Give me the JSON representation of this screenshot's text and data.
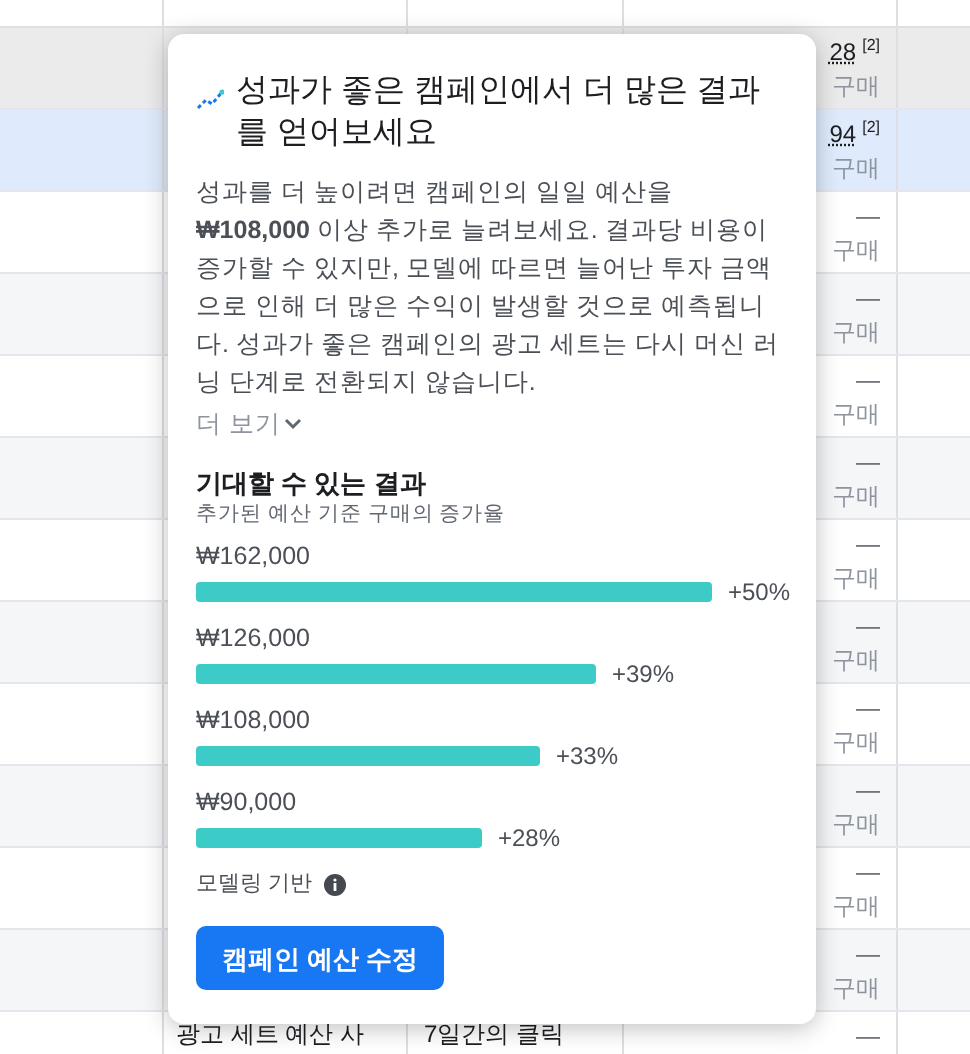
{
  "table": {
    "rows": [
      {
        "value": "28",
        "note": "[2]",
        "sub": "구매",
        "selected": false
      },
      {
        "value": "94",
        "note": "[2]",
        "sub": "구매",
        "selected": true
      },
      {
        "value": "—",
        "sub": "구매",
        "selected": false
      },
      {
        "value": "—",
        "sub": "구매",
        "selected": false
      },
      {
        "value": "—",
        "sub": "구매",
        "selected": false
      },
      {
        "value": "—",
        "sub": "구매",
        "selected": false
      },
      {
        "value": "—",
        "sub": "구매",
        "selected": false
      },
      {
        "value": "—",
        "sub": "구매",
        "selected": false
      },
      {
        "value": "—",
        "sub": "구매",
        "selected": false
      },
      {
        "value": "—",
        "sub": "구매",
        "selected": false
      },
      {
        "value": "—",
        "sub": "구매",
        "selected": false
      },
      {
        "value": "—",
        "sub": "구매",
        "selected": false
      },
      {
        "column_2": "광고 세트 예산 사",
        "column_3": "7일간의 클릭",
        "value": "—",
        "selected": false
      }
    ]
  },
  "popover": {
    "title": "성과가 좋은 캠페인에서 더 많은 결과를 얻어보세요",
    "body": "성과를 더 높이려면 캠페인의 일일 예산을 **₩108,000** 이상 추가로 늘려보세요. 결과당 비용이 증가할 수 있지만, 모델에 따르면 늘어난 투자 금액으로 인해 더 많은 수익이 발생할 것으로 예측됩니다. 성과가 좋은 캠페인의 광고 세트는 다시 머신 러닝 단계로 전환되지 않습니다.",
    "more_link": "더 보기",
    "results_title": "기대할 수 있는 결과",
    "results_subtitle": "추가된 예산 기준 구매의 증가율",
    "bars": [
      {
        "amount": "₩162,000",
        "change": "+50%"
      },
      {
        "amount": "₩126,000",
        "change": "+39%"
      },
      {
        "amount": "₩108,000",
        "change": "+33%"
      },
      {
        "amount": "₩90,000",
        "change": "+28%"
      }
    ],
    "footnote": "모델링 기반",
    "button": "캠페인 예산 수정"
  }
}
